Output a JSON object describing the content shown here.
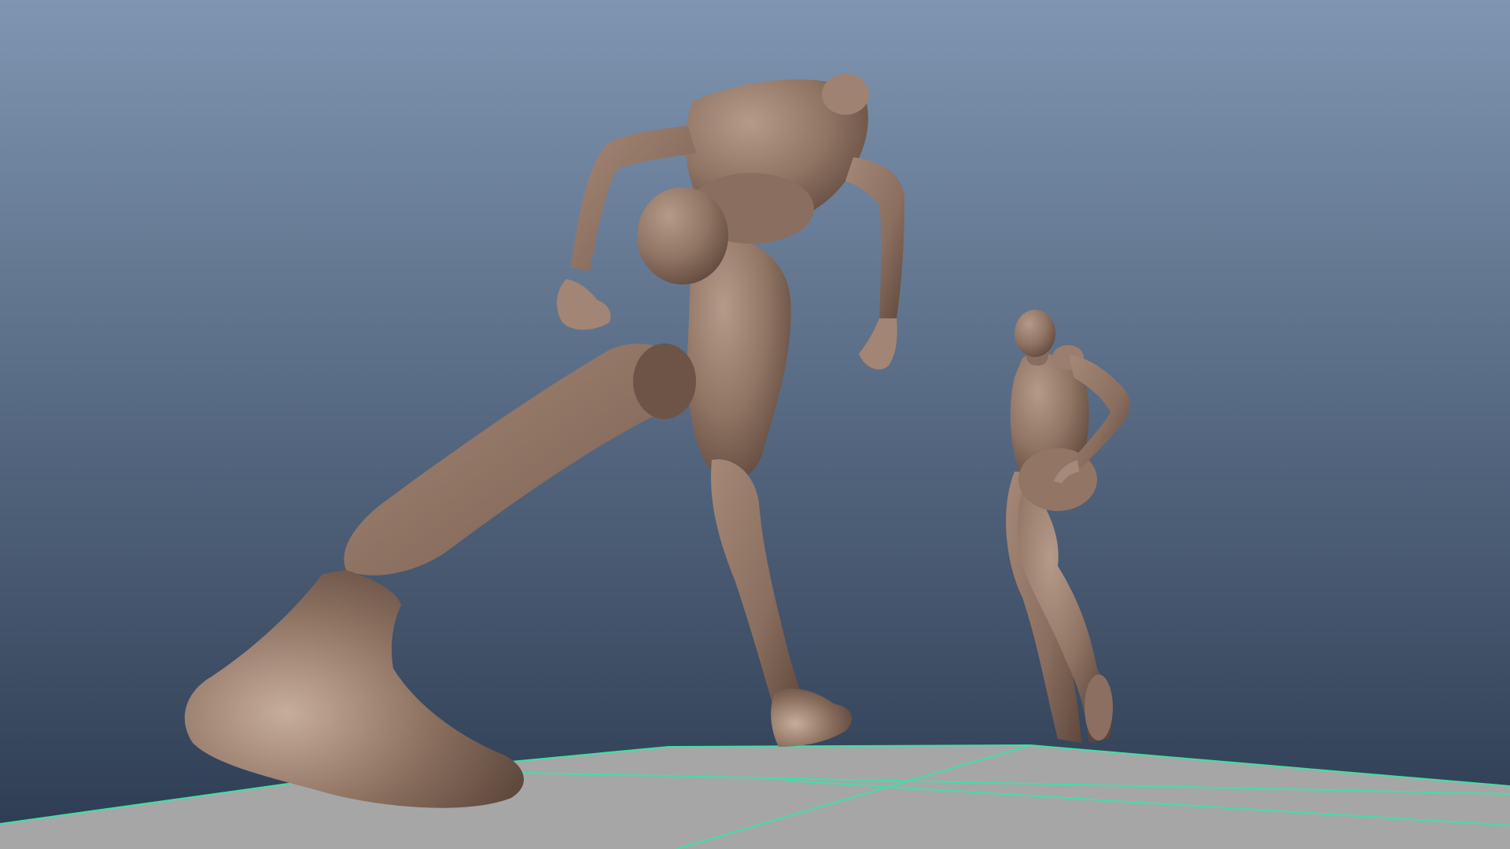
{
  "viewport": {
    "background_top_color": "#7f95b1",
    "background_bottom_color": "#2c3b51",
    "ground_color": "#a6a6a6",
    "grid_line_color": "#3fe0a6",
    "model_color": "#8f7363"
  },
  "icons": {
    "ground_plane": "grid-plane",
    "models": "mannequin"
  }
}
